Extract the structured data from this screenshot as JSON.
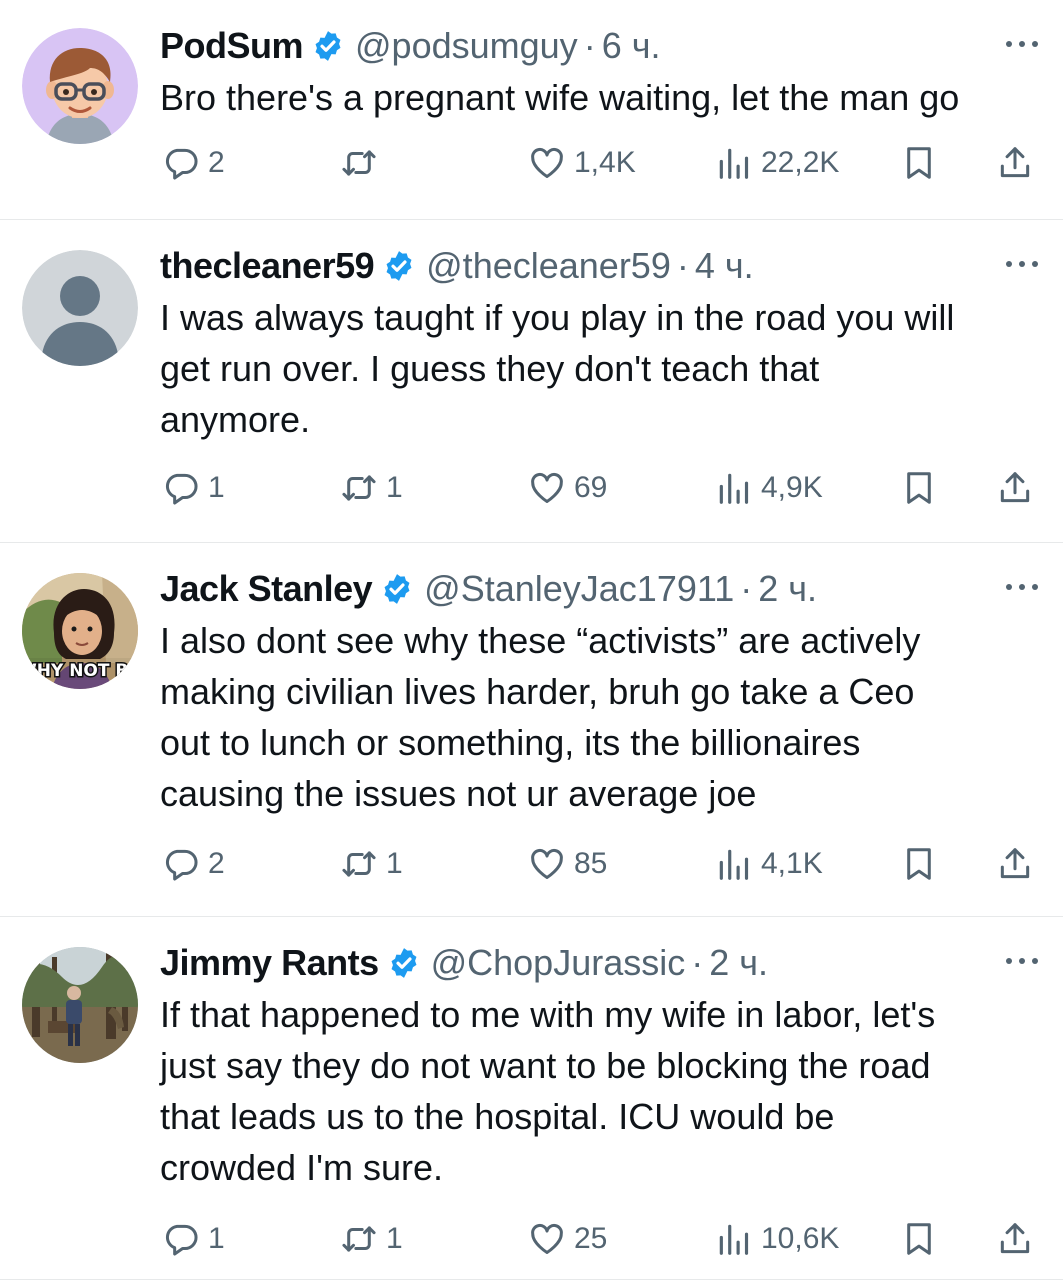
{
  "tweets": [
    {
      "name": "PodSum",
      "handle": "@podsumguy",
      "separator": "·",
      "time": "6 ч.",
      "text": "Bro there's a pregnant wife waiting, let the man go",
      "replies": "2",
      "retweets": "",
      "likes": "1,4K",
      "views": "22,2K",
      "avatar": "cartoon-man-with-glasses"
    },
    {
      "name": "thecleaner59",
      "handle": "@thecleaner59",
      "separator": "·",
      "time": "4 ч.",
      "text": "I was always taught if you play in the road you will\nget run over. I guess they don't teach that\nanymore.",
      "replies": "1",
      "retweets": "1",
      "likes": "69",
      "views": "4,9K",
      "avatar": "default-profile"
    },
    {
      "name": "Jack Stanley",
      "handle": "@StanleyJac17911",
      "separator": "·",
      "time": "2 ч.",
      "text": "I also dont see why these “activists” are actively\nmaking civilian lives harder, bruh go take a Ceo\nout to lunch or something, its the billionaires\ncausing the issues not ur average joe",
      "replies": "2",
      "retweets": "1",
      "likes": "85",
      "views": "4,1K",
      "avatar": "girl-meme",
      "avatar_caption": "WHY NOT BO"
    },
    {
      "name": "Jimmy Rants",
      "handle": "@ChopJurassic",
      "separator": "·",
      "time": "2 ч.",
      "text": "If that happened to me with my wife in labor, let's\njust say they do not want to be blocking the road\nthat leads us to the hospital. ICU would be\ncrowded I'm sure.",
      "replies": "1",
      "retweets": "1",
      "likes": "25",
      "views": "10,6K",
      "avatar": "man-in-forest-photo"
    }
  ],
  "colors": {
    "text": "#0f1419",
    "secondary": "#536471",
    "verified": "#1d9bf0",
    "divider": "#e7e9ea"
  }
}
